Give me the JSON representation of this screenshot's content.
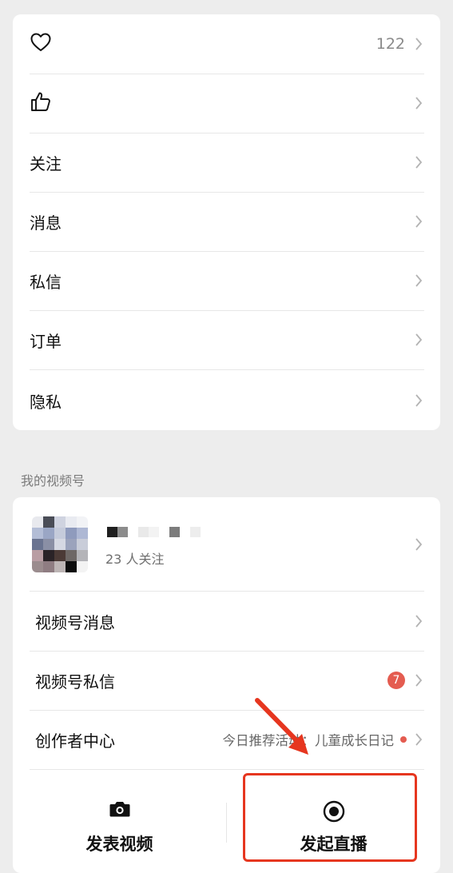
{
  "menu": {
    "items": [
      {
        "name": "favorites",
        "label": "",
        "count": "122"
      },
      {
        "name": "likes",
        "label": "",
        "count": ""
      },
      {
        "name": "follow",
        "label": "关注"
      },
      {
        "name": "messages",
        "label": "消息"
      },
      {
        "name": "private-messages",
        "label": "私信"
      },
      {
        "name": "orders",
        "label": "订单"
      },
      {
        "name": "privacy",
        "label": "隐私"
      }
    ]
  },
  "channels": {
    "section_title": "我的视频号",
    "profile": {
      "followers": "23 人关注"
    },
    "rows": [
      {
        "label": "视频号消息"
      },
      {
        "label": "视频号私信",
        "badge": "7"
      },
      {
        "label": "创作者中心",
        "promo": "今日推荐活动：儿童成长日记"
      }
    ],
    "actions": {
      "post_video": "发表视频",
      "go_live": "发起直播"
    }
  },
  "colors": {
    "accent_red": "#e6361f",
    "badge_red": "#e45c50"
  },
  "icons": {
    "favorites": "heart-outline-icon",
    "likes": "thumbs-up-outline-icon",
    "post_video": "camera-icon",
    "go_live": "record-circle-icon",
    "chevron": "chevron-right-icon"
  }
}
